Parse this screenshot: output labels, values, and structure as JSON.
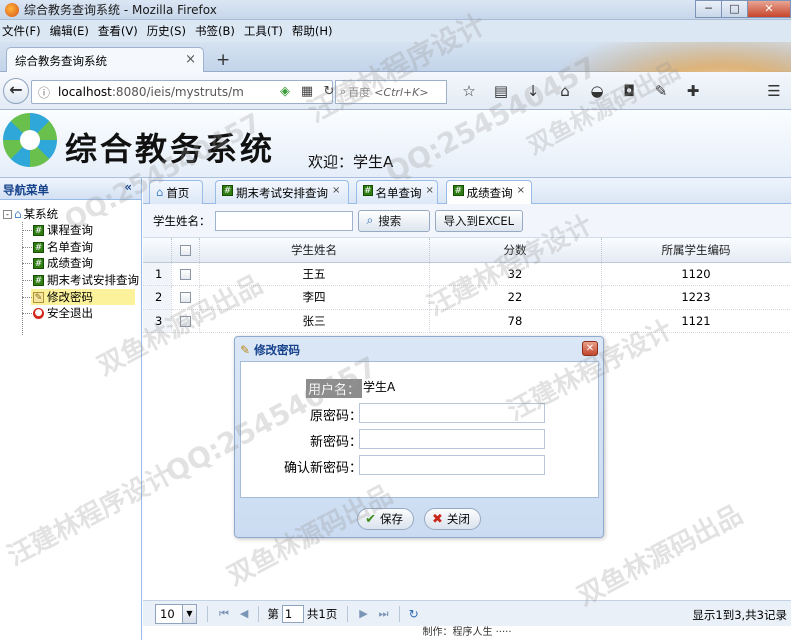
{
  "browser": {
    "window_title": "综合教务查询系统 - Mozilla Firefox",
    "window_buttons": [
      "─",
      "□",
      "✕"
    ],
    "menu": [
      "文件(F)",
      "编辑(E)",
      "查看(V)",
      "历史(S)",
      "书签(B)",
      "工具(T)",
      "帮助(H)"
    ],
    "tab_title": "综合教务查询系统",
    "tab_close": "×",
    "new_tab": "+",
    "url_host": "localhost",
    "url_path": ":8080/ieis/mystruts/m",
    "search_prefix": "百度",
    "search_placeholder": "<Ctrl+K>",
    "icons": {
      "back": "arrow-left-icon",
      "info": "info-icon",
      "shield": "shield-icon",
      "qr": "qr-icon",
      "reload": "reload-icon",
      "search": "search-icon",
      "star": "star-icon",
      "reader": "reader-icon",
      "download": "download-icon",
      "home": "home-icon",
      "chat": "chat-icon",
      "pocket": "pocket-icon",
      "menu": "menu-icon"
    }
  },
  "app": {
    "title": "综合教务系统",
    "welcome": "欢迎：学生A"
  },
  "sidebar": {
    "header": "导航菜单",
    "collapse": "«",
    "root": "某系统",
    "root_toggle": "-",
    "items": [
      {
        "label": "课程查询",
        "icon": "grid-icon"
      },
      {
        "label": "名单查询",
        "icon": "grid-icon"
      },
      {
        "label": "成绩查询",
        "icon": "grid-icon"
      },
      {
        "label": "期末考试安排查询",
        "icon": "grid-icon"
      },
      {
        "label": "修改密码",
        "icon": "edit-icon",
        "selected": true
      },
      {
        "label": "安全退出",
        "icon": "exit-icon"
      }
    ]
  },
  "tabs": [
    {
      "label": "首页",
      "closable": false
    },
    {
      "label": "期末考试安排查询",
      "closable": true
    },
    {
      "label": "名单查询",
      "closable": true
    },
    {
      "label": "成绩查询",
      "closable": true,
      "active": true
    }
  ],
  "tab_close_glyph": "×",
  "toolbar": {
    "name_label": "学生姓名：",
    "name_value": "",
    "search_button": "搜索",
    "export_button": "导入到EXCEL"
  },
  "grid": {
    "columns": [
      "学生姓名",
      "分数",
      "所属学生编码"
    ],
    "rows": [
      {
        "no": "1",
        "name": "王五",
        "score": "32",
        "code": "1120"
      },
      {
        "no": "2",
        "name": "李四",
        "score": "22",
        "code": "1223"
      },
      {
        "no": "3",
        "name": "张三",
        "score": "78",
        "code": "1121"
      }
    ]
  },
  "pager": {
    "page_size": "10",
    "page_label_prefix": "第",
    "page_value": "1",
    "page_label_suffix": "共1页",
    "first": "⏮",
    "prev": "◀",
    "next": "▶",
    "last": "⏭",
    "refresh": "↻",
    "info": "显示1到3,共3记录"
  },
  "dialog": {
    "title": "修改密码",
    "close": "✕",
    "fields": [
      {
        "label": "用户名：",
        "value": "学生A",
        "highlight": true
      },
      {
        "label": "原密码：",
        "value": ""
      },
      {
        "label": "新密码：",
        "value": ""
      },
      {
        "label": "确认新密码：",
        "value": ""
      }
    ],
    "save_button": "保存",
    "close_button": "关闭"
  },
  "statusbar": "制作：程序人生 ·····",
  "watermarks": [
    "汪建林程序设计",
    "QQ:254540457",
    "双鱼林源码出品"
  ]
}
